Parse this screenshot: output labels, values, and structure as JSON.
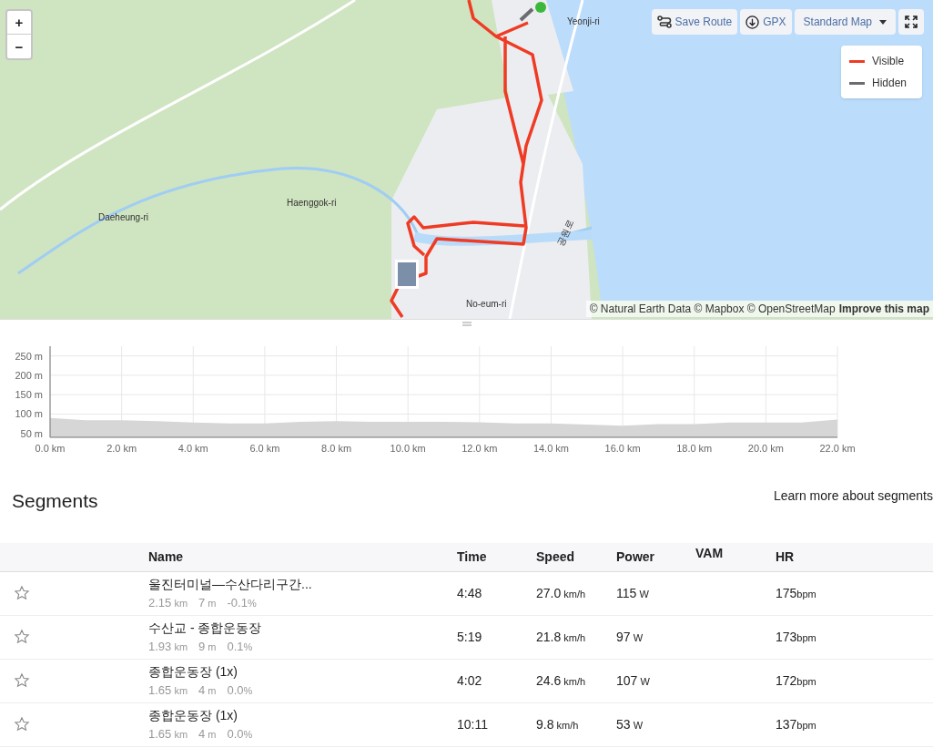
{
  "map": {
    "zoom_in": "+",
    "zoom_out": "−",
    "toolbar": {
      "save_route": "Save Route",
      "gpx": "GPX",
      "map_style": "Standard Map"
    },
    "legend": [
      {
        "label": "Visible",
        "color": "#ef3b24"
      },
      {
        "label": "Hidden",
        "color": "#6b6b70"
      }
    ],
    "place_labels": [
      "Yeonji-ri",
      "Haenggok-ri",
      "Daeheung-ri",
      "No-eum-ri",
      "공원로"
    ],
    "attribution": {
      "text": "© Natural Earth Data © Mapbox © OpenStreetMap",
      "link": "Improve this map"
    }
  },
  "elevation": {
    "chart_data": {
      "type": "area",
      "x": [
        0,
        1,
        2,
        3,
        4,
        5,
        6,
        7,
        8,
        9,
        10,
        11,
        12,
        13,
        14,
        15,
        16,
        17,
        18,
        19,
        20,
        21,
        22
      ],
      "grid": true,
      "series": [
        {
          "color": "#d6d6d6",
          "values": [
            90,
            84,
            84,
            82,
            78,
            76,
            76,
            80,
            82,
            80,
            80,
            80,
            79,
            76,
            76,
            73,
            70,
            74,
            74,
            78,
            78,
            78,
            86
          ]
        }
      ],
      "xlim": [
        0,
        22
      ],
      "ylim": [
        40,
        275
      ],
      "xticks": [
        {
          "value": 0,
          "label": "0.0 km"
        },
        {
          "value": 2,
          "label": "2.0 km"
        },
        {
          "value": 4,
          "label": "4.0 km"
        },
        {
          "value": 6,
          "label": "6.0 km"
        },
        {
          "value": 8,
          "label": "8.0 km"
        },
        {
          "value": 10,
          "label": "10.0 km"
        },
        {
          "value": 12,
          "label": "12.0 km"
        },
        {
          "value": 14,
          "label": "14.0 km"
        },
        {
          "value": 16,
          "label": "16.0 km"
        },
        {
          "value": 18,
          "label": "18.0 km"
        },
        {
          "value": 20,
          "label": "20.0 km"
        },
        {
          "value": 22,
          "label": "22.0 km"
        }
      ],
      "yticks": [
        {
          "value": 50,
          "label": "50 m"
        },
        {
          "value": 100,
          "label": "100 m"
        },
        {
          "value": 150,
          "label": "150 m"
        },
        {
          "value": 200,
          "label": "200 m"
        },
        {
          "value": 250,
          "label": "250 m"
        }
      ]
    }
  },
  "segments": {
    "title": "Segments",
    "learn_more": "Learn more about segments",
    "columns": [
      "Name",
      "Time",
      "Speed",
      "Power",
      "VAM",
      "HR"
    ],
    "rows": [
      {
        "starred": false,
        "name": "울진터미널—수산다리구간...",
        "distance": "2.15",
        "distance_unit": "km",
        "elev": "7",
        "elev_unit": "m",
        "grade": "-0.1",
        "grade_unit": "%",
        "time": "4:48",
        "speed": "27.0",
        "speed_unit": "km/h",
        "power": "115",
        "power_unit": "W",
        "hr": "175",
        "hr_unit": "bpm"
      },
      {
        "starred": false,
        "name": "수산교 - 종합운동장",
        "distance": "1.93",
        "distance_unit": "km",
        "elev": "9",
        "elev_unit": "m",
        "grade": "0.1",
        "grade_unit": "%",
        "time": "5:19",
        "speed": "21.8",
        "speed_unit": "km/h",
        "power": "97",
        "power_unit": "W",
        "hr": "173",
        "hr_unit": "bpm"
      },
      {
        "starred": false,
        "name": "종합운동장 (1x)",
        "distance": "1.65",
        "distance_unit": "km",
        "elev": "4",
        "elev_unit": "m",
        "grade": "0.0",
        "grade_unit": "%",
        "time": "4:02",
        "speed": "24.6",
        "speed_unit": "km/h",
        "power": "107",
        "power_unit": "W",
        "hr": "172",
        "hr_unit": "bpm"
      },
      {
        "starred": false,
        "name": "종합운동장 (1x)",
        "distance": "1.65",
        "distance_unit": "km",
        "elev": "4",
        "elev_unit": "m",
        "grade": "0.0",
        "grade_unit": "%",
        "time": "10:11",
        "speed": "9.8",
        "speed_unit": "km/h",
        "power": "53",
        "power_unit": "W",
        "hr": "137",
        "hr_unit": "bpm"
      }
    ]
  }
}
